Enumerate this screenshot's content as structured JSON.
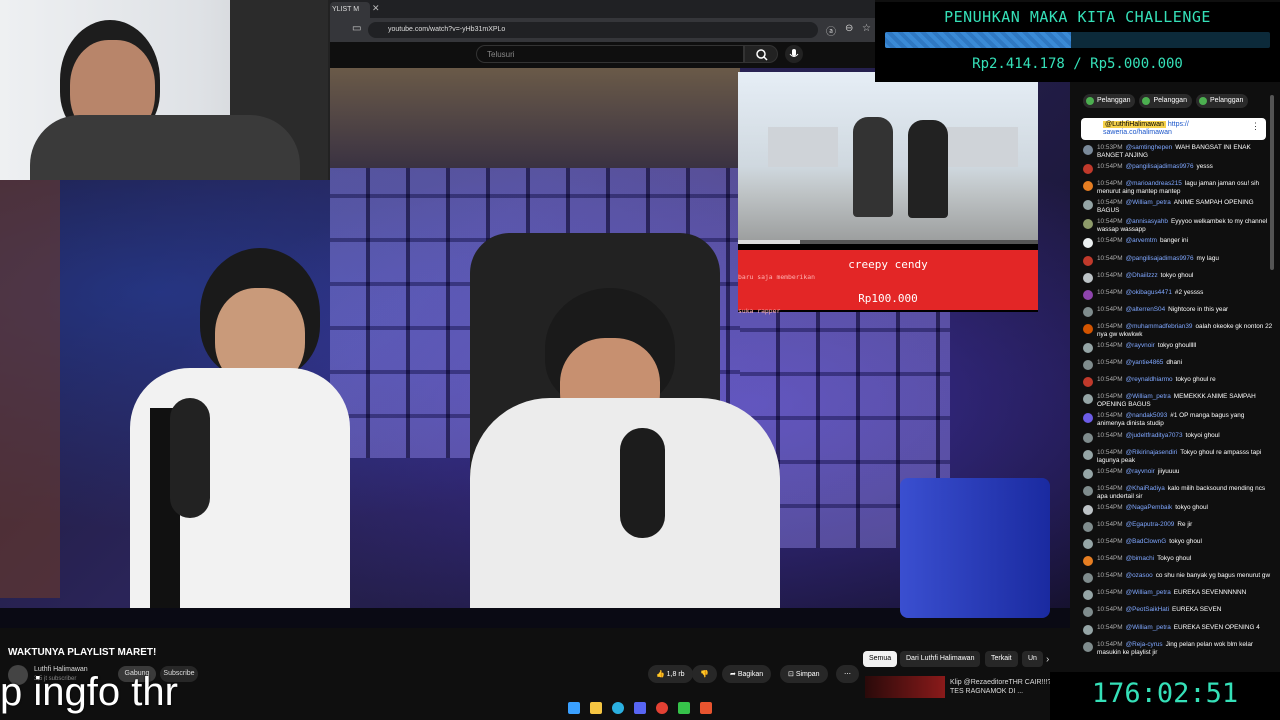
{
  "browser": {
    "tab_title": "YLIST M",
    "url": "youtube.com/watch?v=-yHb31mXPLo"
  },
  "youtube": {
    "search_placeholder": "Telusuri"
  },
  "challenge": {
    "title": "PENUHKAN MAKA KITA CHALLENGE",
    "amount": "Rp2.414.178 / Rp5.000.000",
    "progress_fraction": 0.483
  },
  "donation": {
    "line1_name": "creepy cendy",
    "line1_rest": " baru saja memberikan",
    "amount": "Rp100.000",
    "message": "suka rapper"
  },
  "chat": {
    "badges": [
      "Pelanggan",
      "Pelanggan",
      "Pelanggan"
    ],
    "pinned_name": "@LuthfiHalimawan",
    "pinned_link": "https://",
    "pinned_link2": "saweria.co/halimawan",
    "messages": [
      {
        "time": "10:53PM",
        "name": "@samtinghepen",
        "text": "WAH BANGSAT INI ENAK BANGET ANJING",
        "color": "#7a8a9a"
      },
      {
        "time": "10:54PM",
        "name": "@pangilisajadimas9976",
        "text": "yesss",
        "color": "#c0392b"
      },
      {
        "time": "10:54PM",
        "name": "@marioandreas215",
        "text": "lagu jaman jaman osu! sih menurut aing mantep mantep",
        "color": "#e67e22"
      },
      {
        "time": "10:54PM",
        "name": "@William_petra",
        "text": "ANIME SAMPAH OPENING BAGUS",
        "color": "#95a5a6"
      },
      {
        "time": "10:54PM",
        "name": "@annisasyahb",
        "text": "Eyyyoo welkambek to my channel wassap wassapp",
        "color": "#8e9b6a"
      },
      {
        "time": "10:54PM",
        "name": "@arvemtm",
        "text": "banger ini",
        "color": "#ecf0f1"
      },
      {
        "time": "10:54PM",
        "name": "@pangilisajadimas9976",
        "text": "my lagu",
        "color": "#c0392b"
      },
      {
        "time": "10:54PM",
        "name": "@Dhaiilzzz",
        "text": "tokyo ghoul",
        "color": "#bdc3c7"
      },
      {
        "time": "10:54PM",
        "name": "@okibagus4471",
        "text": "#2 yessss",
        "color": "#8e44ad"
      },
      {
        "time": "10:54PM",
        "name": "@alterrenS04",
        "text": "Nightcore in this year",
        "color": "#7f8c8d"
      },
      {
        "time": "10:54PM",
        "name": "@muhammadfebrian39",
        "text": "oalah okeoke gk nonton 22 nya gw wkwkwk",
        "color": "#d35400"
      },
      {
        "time": "10:54PM",
        "name": "@rayvnoir",
        "text": "tokyo ghoulllll",
        "color": "#95a5a6"
      },
      {
        "time": "10:54PM",
        "name": "@yantie4865",
        "text": "dhani",
        "color": "#7f8c8d"
      },
      {
        "time": "10:54PM",
        "name": "@reynaldhiarmo",
        "text": "tokyo ghoul re",
        "color": "#c0392b"
      },
      {
        "time": "10:54PM",
        "name": "@William_petra",
        "text": "MEMEKKK ANIME SAMPAH OPENING BAGUS",
        "color": "#95a5a6"
      },
      {
        "time": "10:54PM",
        "name": "@nandak5093",
        "text": "#1 OP manga bagus yang animenya dinista studip",
        "color": "#6c5ce7"
      },
      {
        "time": "10:54PM",
        "name": "@judeltfraditya7073",
        "text": "tokyoi ghoul",
        "color": "#7f8c8d"
      },
      {
        "time": "10:54PM",
        "name": "@Rikirinajasendiri",
        "text": "Tokyo ghoul re ampasss tapi lagunya peak",
        "color": "#95a5a6"
      },
      {
        "time": "10:54PM",
        "name": "@rayvnoir",
        "text": "jiiyuuuu",
        "color": "#95a5a6"
      },
      {
        "time": "10:54PM",
        "name": "@KhaiRadiya",
        "text": "kalo milih backsound mending ncs apa undertail sir",
        "color": "#7f8c8d"
      },
      {
        "time": "10:54PM",
        "name": "@NagaPembaik",
        "text": "tokyo ghoul",
        "color": "#bdc3c7"
      },
      {
        "time": "10:54PM",
        "name": "@Egaputra-2009",
        "text": "Re jir",
        "color": "#7f8c8d"
      },
      {
        "time": "10:54PM",
        "name": "@BadClownG",
        "text": "tokyo ghoul",
        "color": "#95a5a6"
      },
      {
        "time": "10:54PM",
        "name": "@bimachi",
        "text": "Tokyo ghoul",
        "color": "#e67e22"
      },
      {
        "time": "10:54PM",
        "name": "@ozasoo",
        "text": "co shu nie banyak yg bagus menurut gw",
        "color": "#7f8c8d"
      },
      {
        "time": "10:54PM",
        "name": "@William_petra",
        "text": "EUREKA SEVENNNNNN",
        "color": "#95a5a6"
      },
      {
        "time": "10:54PM",
        "name": "@PeotSaikHati",
        "text": "EUREKA SEVEN",
        "color": "#7f8c8d"
      },
      {
        "time": "10:54PM",
        "name": "@William_petra",
        "text": "EUREKA SEVEN OPENING 4",
        "color": "#95a5a6"
      },
      {
        "time": "10:54PM",
        "name": "@Reja-cyrus",
        "text": "Jing pelan pelan wok blm kelar masukin ke playlist jir",
        "color": "#7f8c8d"
      }
    ]
  },
  "video": {
    "title": "WAKTUNYA PLAYLIST MARET!",
    "channel": "Luthfi Halimawan",
    "subs": "3,5 jt subscriber",
    "join": "Gabung",
    "subscribe": "Subscribe",
    "likes": "1,8 rb",
    "share": "Bagikan",
    "save": "Simpan",
    "subtitle": "p ingfo thr"
  },
  "related": {
    "chips": [
      "Semua",
      "Dari Luthfi Halimawan",
      "Terkait",
      "Un"
    ],
    "title": "Klip @RezaeditoreTHR CAIR!!!?? TES RAGNAMOK DI ..."
  },
  "timer": "176:02:51"
}
